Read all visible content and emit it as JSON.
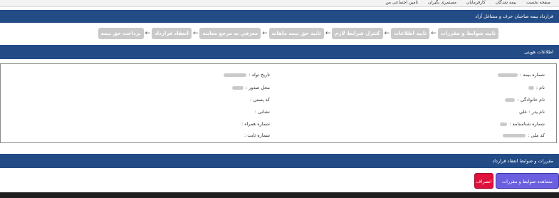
{
  "topnav": {
    "items": [
      "صفحه نخست",
      "بیمه شدگان",
      "کارفرمایان",
      "مستمری بگیران",
      "تامین اجتماعی من"
    ]
  },
  "contract_panel": {
    "title": "قرارداد بیمه صاحبان حرف و مشاغل آزاد"
  },
  "steps": [
    "تایید ضوابط و مقررات",
    "تایید اطلاعات",
    "کنترل شرایط لازم",
    "تایید حق بیمه ماهانه",
    "معرفی به مرجع معاینه",
    "انعقاد قرارداد",
    "پرداخت حق بیمه"
  ],
  "identity_panel": {
    "title": "اطلاعات هویتی",
    "fields": {
      "insurance_number": "شماره بیمه :",
      "first_name": "نام :",
      "last_name": "نام خانوادگی :",
      "father_name": "نام پدر : علي",
      "id_number": "شماره شناسنامه :",
      "national_code": "کد ملی :",
      "birth_date": "تاریخ تولد :",
      "issue_place": "محل صدور :",
      "postal_code": "کد پستی :",
      "address": "نشانی :",
      "mobile": "شماره همراه :",
      "landline": "شماره ثابت :"
    }
  },
  "terms_panel": {
    "title": "مقررات و ضوابط انعقاد قرارداد"
  },
  "buttons": {
    "view_terms": "مشاهده ضوابط و مقررات",
    "cancel": "انصراف"
  }
}
